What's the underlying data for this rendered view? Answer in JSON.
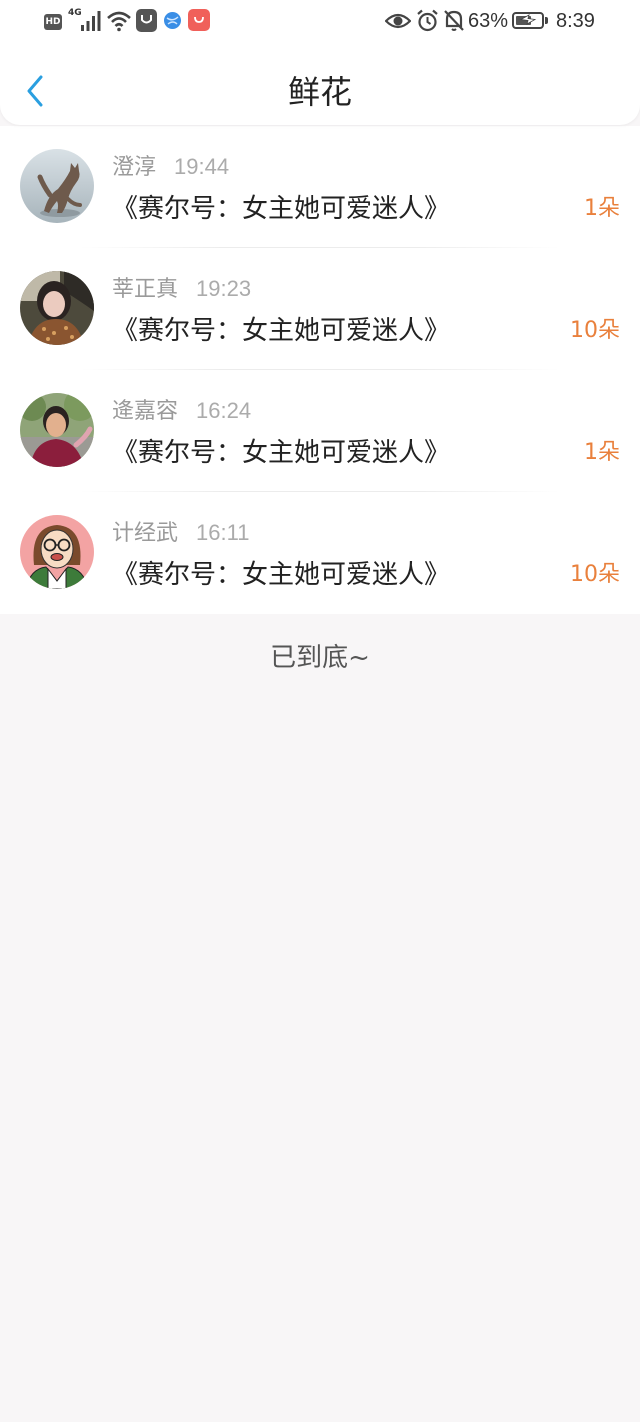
{
  "status_bar": {
    "hd_label": "HD",
    "network_label": "4G",
    "battery_percent": "63%",
    "battery_level": 0.63,
    "time": "8:39",
    "icons": [
      "signal-icon",
      "wifi-icon",
      "app-icon",
      "browser-icon",
      "shop-icon",
      "eye-icon",
      "alarm-icon",
      "bell-off-icon",
      "battery-icon"
    ]
  },
  "header": {
    "title": "鲜花",
    "back_icon": "chevron-left-icon"
  },
  "gifts": [
    {
      "name": "澄淳",
      "time": "19:44",
      "title": "《赛尔号：女主她可爱迷人》",
      "amount": "1朵"
    },
    {
      "name": "莘正真",
      "time": "19:23",
      "title": "《赛尔号：女主她可爱迷人》",
      "amount": "10朵"
    },
    {
      "name": "逄嘉容",
      "time": "16:24",
      "title": "《赛尔号：女主她可爱迷人》",
      "amount": "1朵"
    },
    {
      "name": "计经武",
      "time": "16:11",
      "title": "《赛尔号：女主她可爱迷人》",
      "amount": "10朵"
    }
  ],
  "footer": {
    "end_text": "已到底~"
  },
  "colors": {
    "accent": "#2a9fe0",
    "amount": "#e9803c",
    "background": "#f8f6f7"
  }
}
